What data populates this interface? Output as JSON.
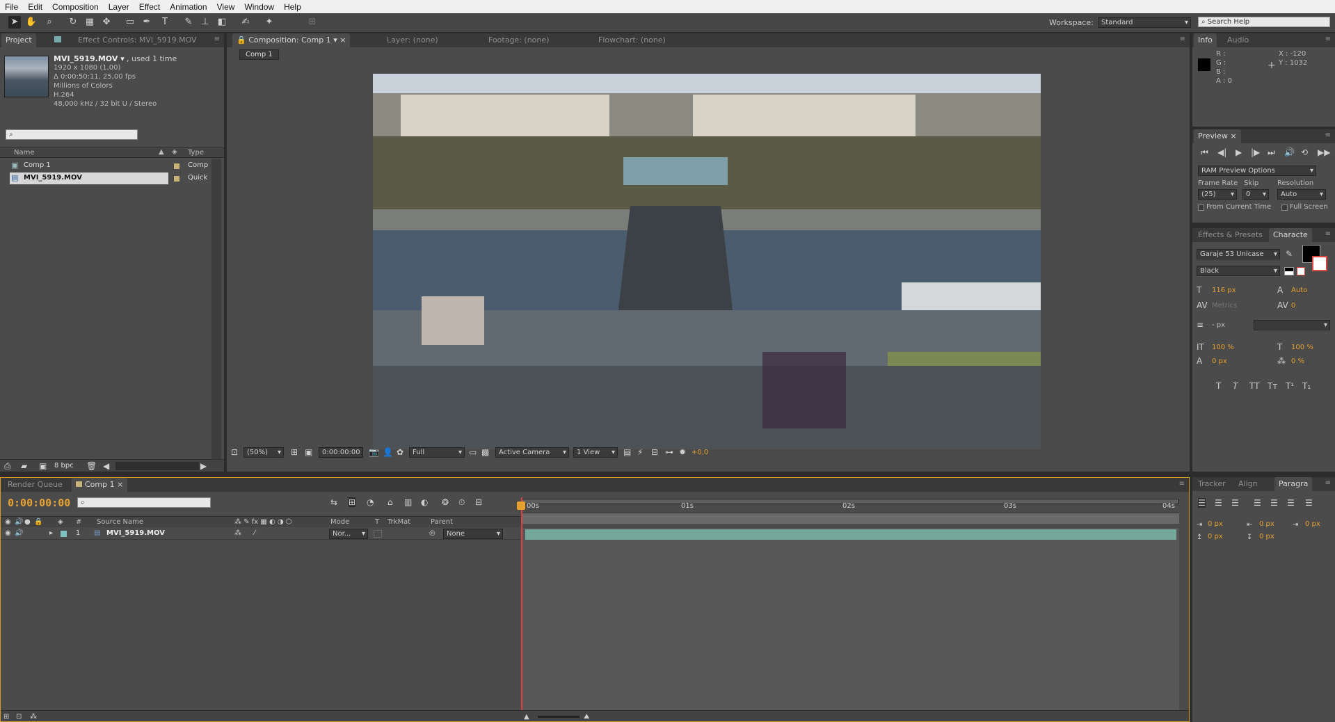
{
  "menu": [
    "File",
    "Edit",
    "Composition",
    "Layer",
    "Effect",
    "Animation",
    "View",
    "Window",
    "Help"
  ],
  "toolbar": {
    "tools": [
      "selection-tool",
      "hand-tool",
      "zoom-tool",
      "rotation-tool",
      "camera-tool",
      "pan-behind-tool",
      "rectangle-mask-tool",
      "pen-tool",
      "type-tool",
      "brush-tool",
      "clone-stamp-tool",
      "eraser-tool",
      "roto-brush-tool",
      "puppet-pin-tool"
    ],
    "workspace_label": "Workspace:",
    "workspace_value": "Standard",
    "search_placeholder": "Search Help"
  },
  "project": {
    "tabs": [
      "Project",
      "Effect Controls: MVI_5919.MOV"
    ],
    "file_name": "MVI_5919.MOV ▾",
    "usage": ", used 1 time",
    "info_lines": [
      "1920 x 1080 (1,00)",
      "Δ 0:00:50:11, 25,00 fps",
      "Millions of Colors",
      "H.264",
      "48,000 kHz / 32 bit U / Stereo"
    ],
    "search_placeholder": "",
    "columns": {
      "name": "Name",
      "type": "Type"
    },
    "items": [
      {
        "name": "Comp 1",
        "type": "Comp",
        "selected": false
      },
      {
        "name": "MVI_5919.MOV",
        "type": "Quick",
        "selected": true
      }
    ],
    "bpc": "8 bpc"
  },
  "composition": {
    "tabs": [
      "Composition: Comp 1",
      "Layer: (none)",
      "Footage: (none)",
      "Flowchart: (none)"
    ],
    "breadcrumb": "Comp 1",
    "zoom": "(50%)",
    "timecode": "0:00:00:00",
    "resolution": "Full",
    "camera": "Active Camera",
    "views": "1 View",
    "exposure": "+0,0"
  },
  "info": {
    "tabs": [
      "Info",
      "Audio"
    ],
    "rgba": [
      "R :",
      "G :",
      "B :",
      "A : 0"
    ],
    "x": "X : -120",
    "y": "Y : 1032"
  },
  "preview": {
    "tab": "Preview",
    "options": "RAM Preview Options",
    "frame_rate_label": "Frame Rate",
    "skip_label": "Skip",
    "resolution_label": "Resolution",
    "frame_rate": "(25)",
    "skip": "0",
    "resolution": "Auto",
    "from_current": "From Current Time",
    "full_screen": "Full Screen"
  },
  "character": {
    "tabs": [
      "Effects & Presets",
      "Characte"
    ],
    "font": "Garaje 53 Unicase",
    "style": "Black",
    "size": "116 px",
    "leading": "Auto",
    "kerning": "Metrics",
    "tracking": "0",
    "stroke": "- px",
    "vscale": "100 %",
    "hscale": "100 %",
    "baseline": "0 px",
    "tsume": "0 %",
    "styles": [
      "T",
      "T",
      "TT",
      "Tт",
      "T¹",
      "T₁"
    ]
  },
  "paragraph": {
    "tabs": [
      "Tracker",
      "Align",
      "Paragra"
    ],
    "indents": [
      "0 px",
      "0 px",
      "0 px",
      "0 px",
      "0 px"
    ]
  },
  "timeline": {
    "tabs": [
      "Render Queue",
      "Comp 1"
    ],
    "timecode": "0:00:00:00",
    "ruler": [
      "00s",
      "01s",
      "02s",
      "03s",
      "04s"
    ],
    "columns": {
      "num": "#",
      "source": "Source Name",
      "mode": "Mode",
      "t": "T",
      "trkmat": "TrkMat",
      "parent": "Parent"
    },
    "layers": [
      {
        "num": "1",
        "name": "MVI_5919.MOV",
        "mode": "Nor...",
        "parent": "None"
      }
    ]
  },
  "colors": {
    "accent": "#e5a02f",
    "layer_bar": "#73a89a",
    "bg": "#4b4b4b"
  }
}
